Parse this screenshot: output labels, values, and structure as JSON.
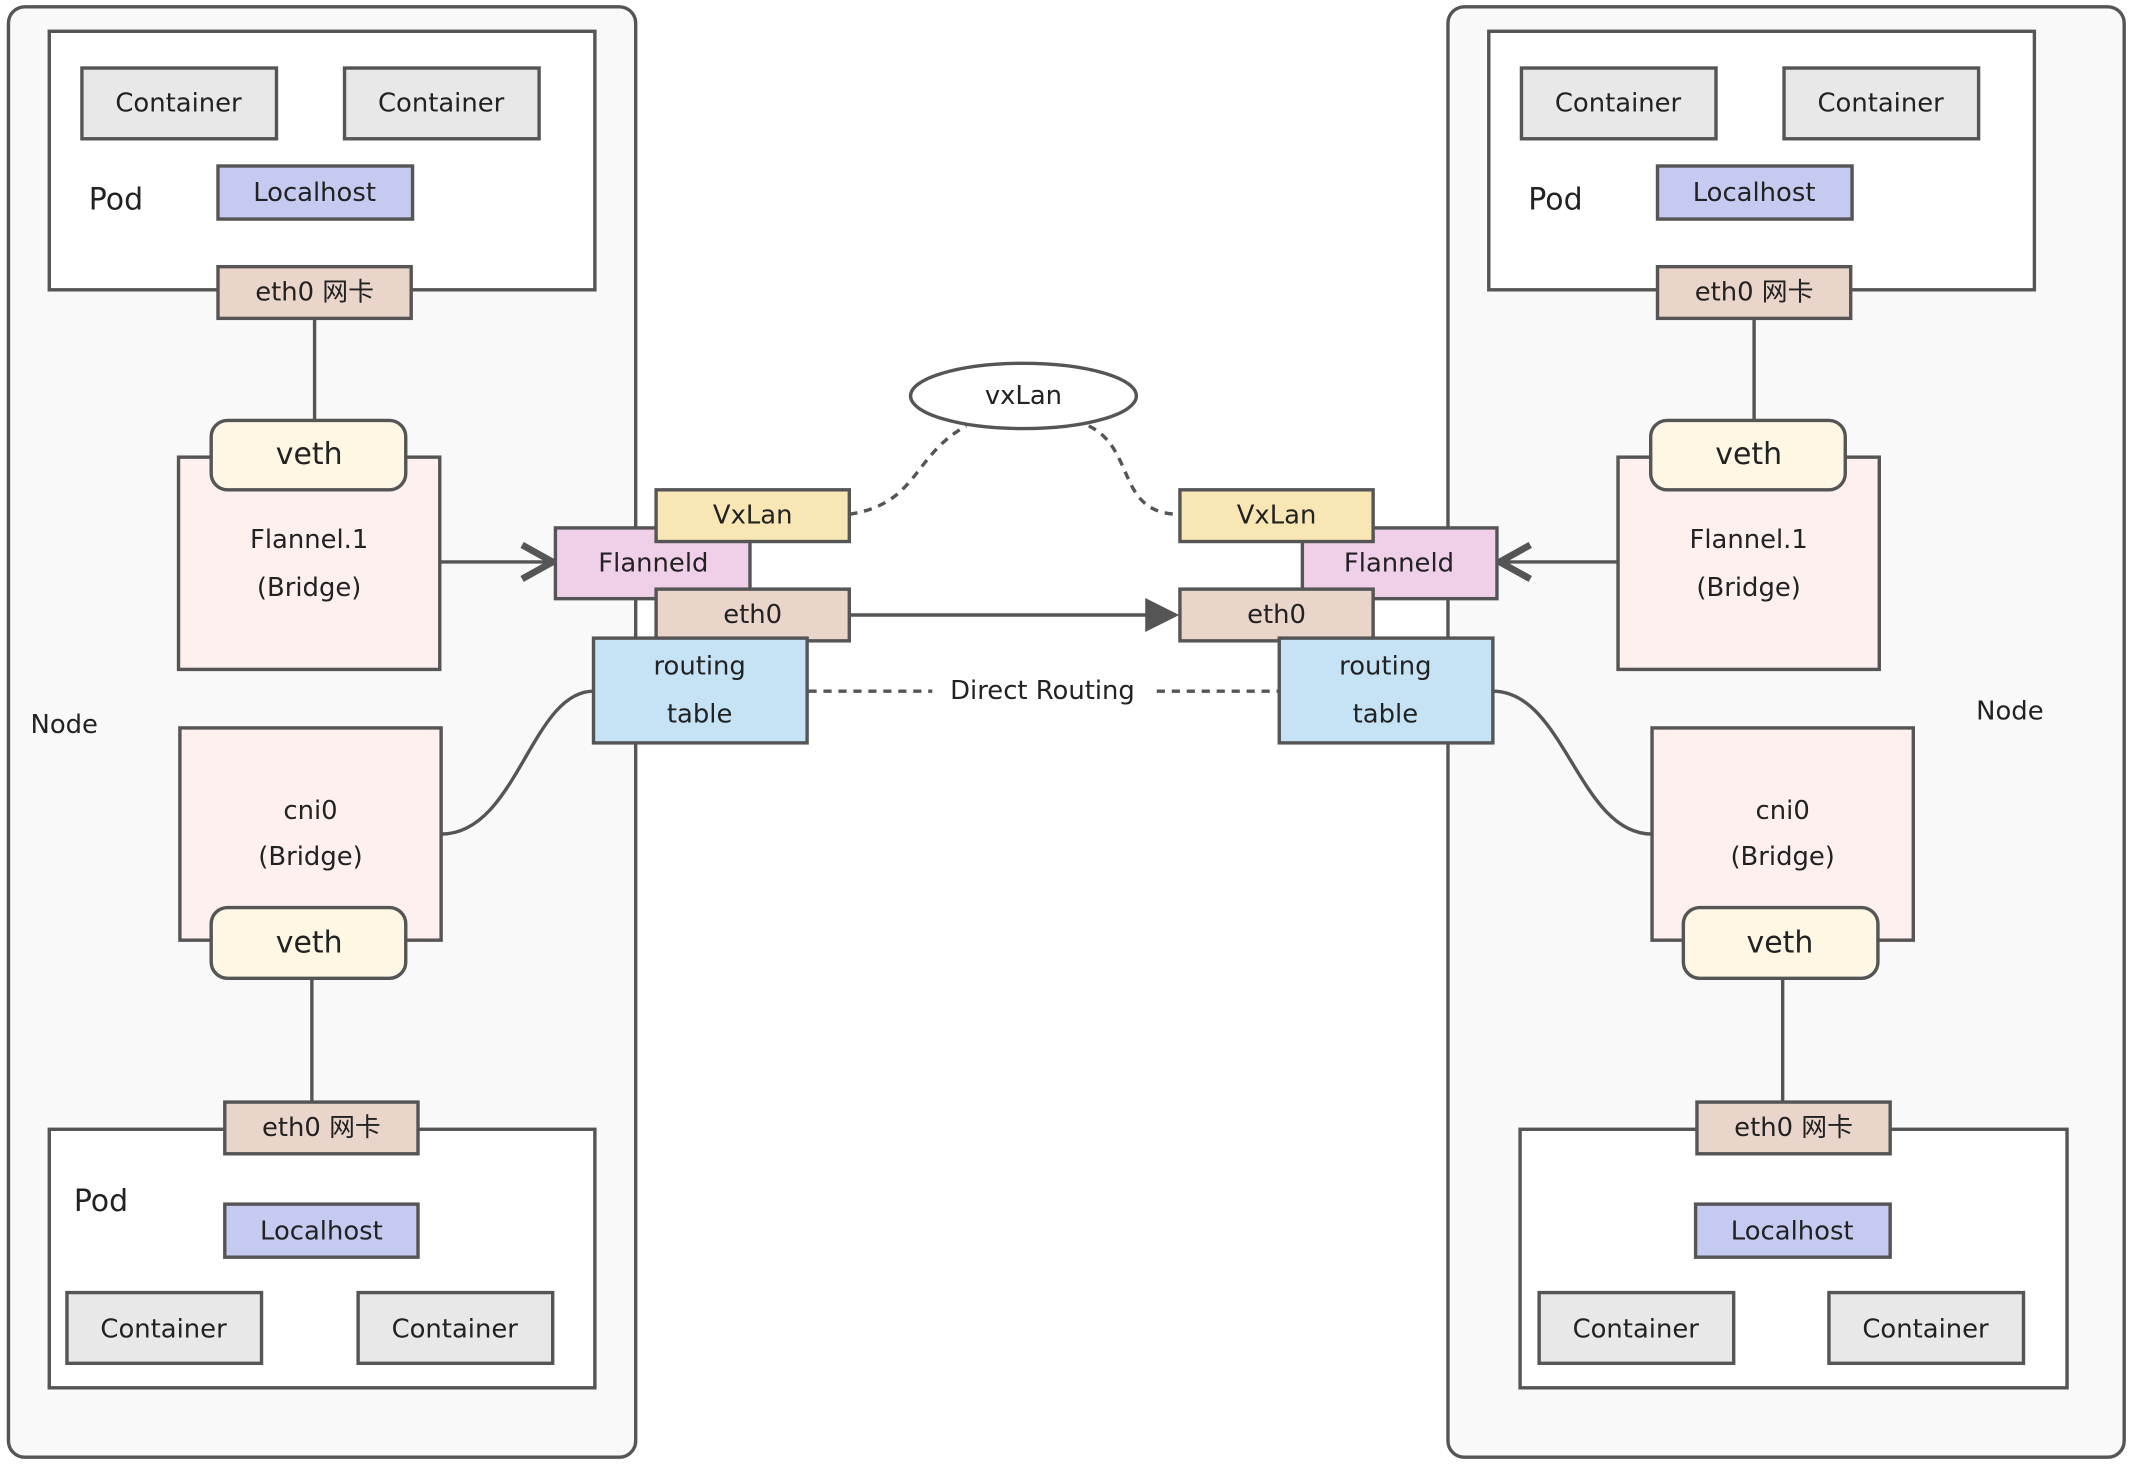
{
  "colors": {
    "container": "#e8e8e8",
    "localhost": "#c5cbf0",
    "eth0": "#ead5cb",
    "veth": "#fdf7e3",
    "bridge": "#fdf0ef",
    "vxlan": "#f8e7b5",
    "flanneld": "#f0d0e8",
    "routing": "#c5e3f5",
    "stroke": "#555555"
  },
  "left_node": {
    "label": "Node",
    "top_pod": {
      "label": "Pod",
      "containers": [
        "Container",
        "Container"
      ],
      "localhost": "Localhost",
      "eth0": "eth0 网卡"
    },
    "flannel": {
      "veth": "veth",
      "name": "Flannel.1",
      "type": "(Bridge)"
    },
    "cni": {
      "veth": "veth",
      "name": "cni0",
      "type": "(Bridge)"
    },
    "bottom_pod": {
      "label": "Pod",
      "containers": [
        "Container",
        "Container"
      ],
      "localhost": "Localhost",
      "eth0": "eth0 网卡"
    },
    "vxlan": "VxLan",
    "flanneld": "Flanneld",
    "eth0": "eth0",
    "routing": [
      "routing",
      "table"
    ]
  },
  "right_node": {
    "label": "Node",
    "top_pod": {
      "label": "Pod",
      "containers": [
        "Container",
        "Container"
      ],
      "localhost": "Localhost",
      "eth0": "eth0 网卡"
    },
    "flannel": {
      "veth": "veth",
      "name": "Flannel.1",
      "type": "(Bridge)"
    },
    "cni": {
      "veth": "veth",
      "name": "cni0",
      "type": "(Bridge)"
    },
    "bottom_pod": {
      "containers": [
        "Container",
        "Container"
      ],
      "localhost": "Localhost",
      "eth0": "eth0 网卡"
    },
    "vxlan": "VxLan",
    "flanneld": "Flanneld",
    "eth0": "eth0",
    "routing": [
      "routing",
      "table"
    ]
  },
  "middle": {
    "vxlan_tunnel": "vxLan",
    "direct_routing": "Direct Routing"
  }
}
